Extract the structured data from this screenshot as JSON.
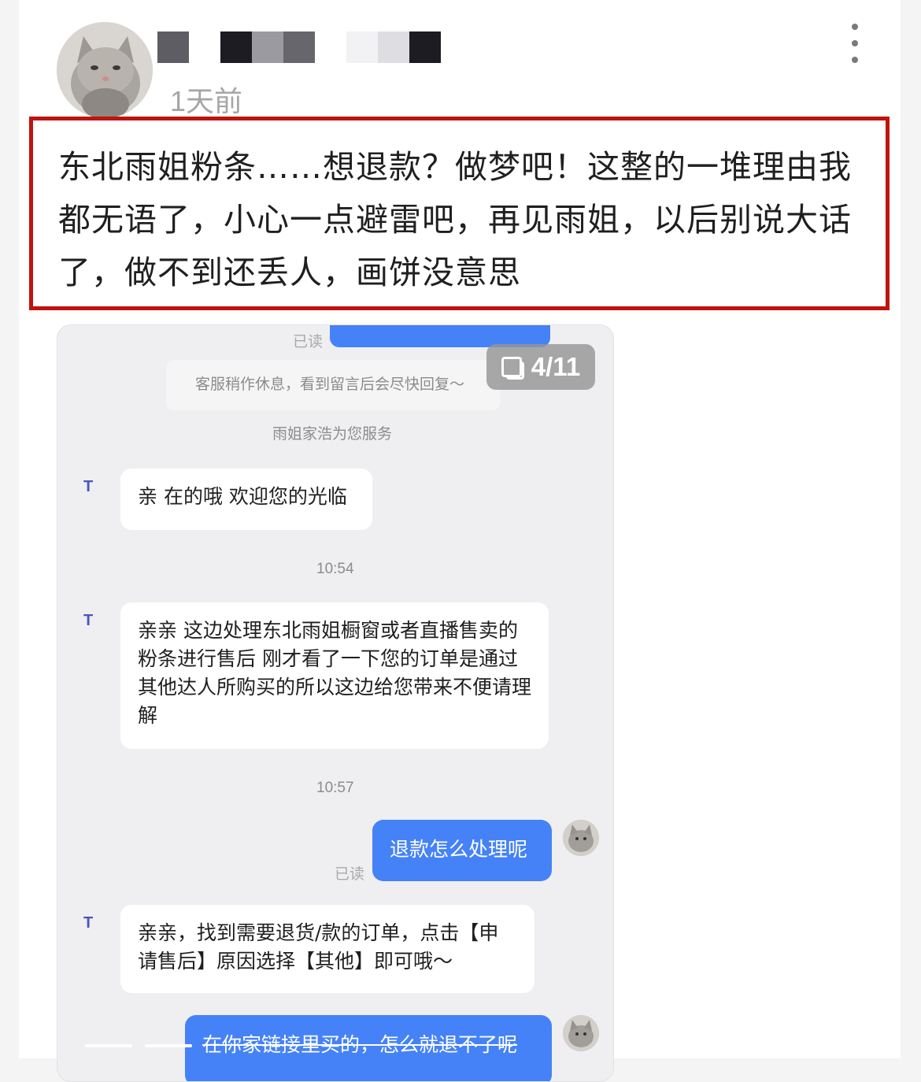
{
  "post": {
    "time_ago": "1天前",
    "text": "东北雨姐粉条……想退款？做梦吧！这整的一堆理由我都无语了，小心一点避雷吧，再见雨姐，以后别说大话了，做不到还丢人，画饼没意思"
  },
  "image_counter": "4/11",
  "chat": {
    "read_top": "已读",
    "system_offline": "客服稍作休息，看到留言后会尽快回复～",
    "system_service": "雨姐家浩为您服务",
    "agent_badge": "T",
    "messages": [
      {
        "text": "亲 在的哦 欢迎您的光临"
      },
      {
        "time": "10:54"
      },
      {
        "text": "亲亲 这边处理东北雨姐橱窗或者直播售卖的粉条进行售后 刚才看了一下您的订单是通过其他达人所购买的所以这边给您带来不便请理解"
      },
      {
        "time": "10:57"
      },
      {
        "text": "退款怎么处理呢",
        "read": "已读"
      },
      {
        "text": "亲亲，找到需要退货/款的订单，点击【申请售后】原因选择【其他】即可哦～"
      },
      {
        "text": "在你家链接里买的，怎么就退不了呢"
      }
    ]
  },
  "colors": {
    "highlight_border": "#c0130e",
    "user_bubble": "#4582f7",
    "agent_badge": "#4a55c2"
  }
}
